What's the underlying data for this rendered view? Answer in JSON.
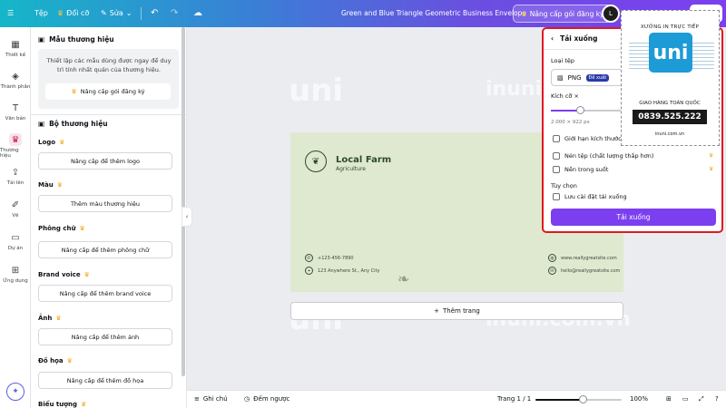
{
  "topbar": {
    "file_label": "Tệp",
    "resize_label": "Đổi cỡ",
    "edit_label": "Sửa",
    "document_title": "Green and Blue Triangle Geometric Business Envelope",
    "upgrade_label": "Nâng cấp gói đăng ký",
    "avatar_initials": "L"
  },
  "rail": {
    "items": [
      {
        "label": "Thiết kế",
        "icon": "design-icon"
      },
      {
        "label": "Thành phần",
        "icon": "elements-icon"
      },
      {
        "label": "Văn bản",
        "icon": "text-icon"
      },
      {
        "label": "Thương hiệu",
        "icon": "brand-icon"
      },
      {
        "label": "Tải lên",
        "icon": "upload-icon"
      },
      {
        "label": "Vẽ",
        "icon": "draw-icon"
      },
      {
        "label": "Dự án",
        "icon": "folder-icon"
      },
      {
        "label": "Ứng dụng",
        "icon": "apps-icon"
      }
    ]
  },
  "panel": {
    "template_heading": "Mẫu thương hiệu",
    "template_info": "Thiết lập các mẫu dùng được ngay để duy trì tính nhất quán của thương hiệu.",
    "template_upgrade": "Nâng cấp gói đăng ký",
    "kit_heading": "Bộ thương hiệu",
    "groups": [
      {
        "label": "Logo",
        "button": "Nâng cấp để thêm logo"
      },
      {
        "label": "Màu",
        "button": "Thêm màu thương hiệu"
      },
      {
        "label": "Phông chữ",
        "button": "Nâng cấp để thêm phông chữ"
      },
      {
        "label": "Brand voice",
        "button": "Nâng cấp để thêm brand voice"
      },
      {
        "label": "Ảnh",
        "button": "Nâng cấp để thêm ảnh"
      },
      {
        "label": "Đồ họa",
        "button": "Nâng cấp để thêm đồ họa"
      },
      {
        "label": "Biểu tượng",
        "button": ""
      }
    ]
  },
  "envelope": {
    "brand_name": "Local Farm",
    "brand_sub": "Agriculture",
    "phone": "+123-456-7890",
    "address": "123 Anywhere St., Any City",
    "website": "www.reallygreatsite.com",
    "email": "hello@reallygreatsite.com"
  },
  "canvas": {
    "add_page": "Thêm trang"
  },
  "bottombar": {
    "notes": "Ghi chú",
    "timer": "Đếm ngược",
    "page": "Trang 1 / 1",
    "zoom": "100%",
    "zoom_level": 1.0
  },
  "download": {
    "title": "Tải xuống",
    "file_type_label": "Loại tệp",
    "file_type": "PNG",
    "recommended": "Đề xuất",
    "size_label": "Kích cỡ ×",
    "size_dims": "2.000 × 922 px",
    "size_level": 0.4,
    "limit_size": "Giới hạn kích thước tệp",
    "compress": "Nén tệp (chất lượng thấp hơn)",
    "transparent": "Nền trong suốt",
    "options_label": "Tùy chọn",
    "save_settings": "Lưu cài đặt tải xuống",
    "download_btn": "Tải xuống"
  },
  "stamp": {
    "top_text": "XƯỞNG IN TRỰC TIẾP",
    "logo_text": "uni",
    "ship_text": "GIAO HÀNG TOÀN QUỐC",
    "phone": "0839.525.222",
    "web": "inuni.com.vn"
  },
  "watermark": {
    "text": "inuni.com.vn",
    "mark": "uni"
  },
  "colors": {
    "topbar_start": "#16b6c9",
    "topbar_end": "#7b3ff0",
    "accent": "#7b3ff0",
    "highlight_border": "#e01820",
    "envelope_bg": "#dfe9cf",
    "brand_green": "#2c4a2e"
  }
}
